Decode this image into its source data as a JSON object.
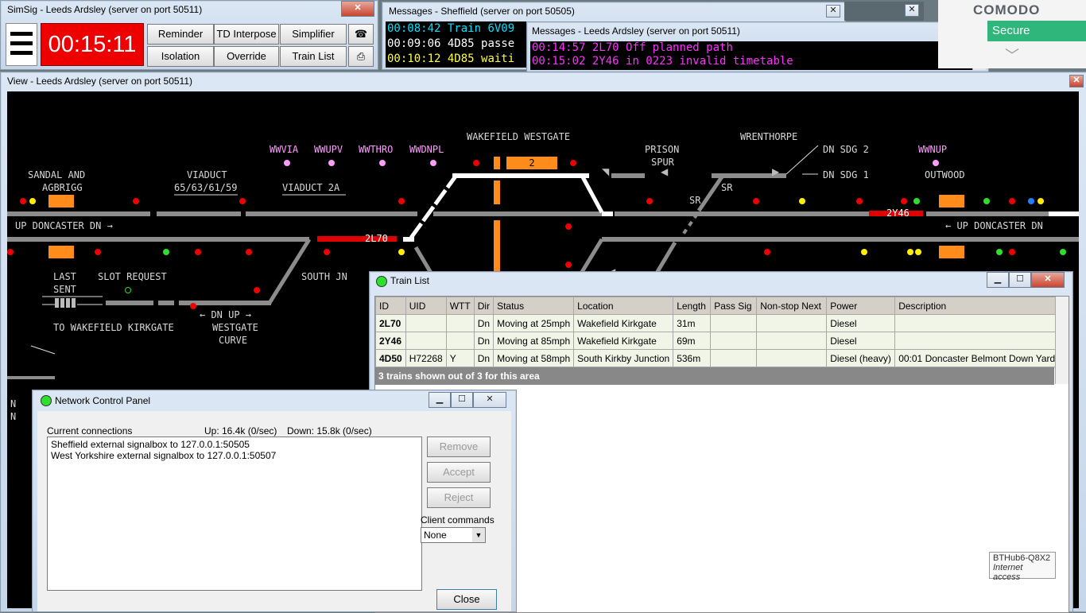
{
  "simsig": {
    "title": "SimSig - Leeds Ardsley (server on port 50511)",
    "clock": "00:15:11",
    "buttons": [
      "Reminder",
      "TD Interpose",
      "Simplifier",
      "Isolation",
      "Override",
      "Train List"
    ],
    "icons": [
      "phone-icon",
      "printer-icon"
    ]
  },
  "messages_sheffield": {
    "title": "Messages - Sheffield (server on port 50505)",
    "lines": [
      {
        "time": "00:08:42",
        "text": "Train 6V09",
        "color": "#00e0ff"
      },
      {
        "time": "00:09:06",
        "text": "4D85 passe",
        "color": "#ffffff"
      },
      {
        "time": "00:10:12",
        "text": "4D85 waiti",
        "color": "#ffff40"
      }
    ]
  },
  "messages_leeds": {
    "title": "Messages - Leeds Ardsley (server on port 50511)",
    "lines": [
      {
        "time": "00:14:57",
        "text": "2L70 Off planned path"
      },
      {
        "time": "00:15:02",
        "text": "2Y46 in 0223 invalid timetable"
      }
    ]
  },
  "comodo": {
    "brand": "COMODO",
    "status": "Secure"
  },
  "view": {
    "title": "View - Leeds Ardsley (server on port 50511)",
    "labels": {
      "sandal": "SANDAL AND",
      "agbrigg": "AGBRIGG",
      "viaduct": "VIADUCT",
      "viaduct_nums": "65/63/61/59",
      "viaduct_2a": "VIADUCT 2A",
      "wwvia": "WWVIA",
      "wwupv": "WWUPV",
      "wwthro": "WWTHRO",
      "wwdnpl": "WWDNPL",
      "wakefield_westgate": "WAKEFIELD WESTGATE",
      "platform_2": "2",
      "prison": "PRISON",
      "spur": "SPUR",
      "wrenthorpe": "WRENTHORPE",
      "dn_sdg_2": "DN SDG 2",
      "dn_sdg_1": "DN SDG 1",
      "wwnup": "WWNUP",
      "outwood": "OUTWOOD",
      "up_doncaster_dn_left": "UP DONCASTER DN",
      "up_doncaster_dn_right": "UP DONCASTER DN",
      "berth_2l70": "2L70",
      "berth_2y46": "2Y46",
      "sr1": "SR",
      "sr2": "SR",
      "last": "LAST",
      "sent": "SENT",
      "slot_request": "SLOT REQUEST",
      "south_jn": "SOUTH JN",
      "to_wakefield_kirkgate": "TO WAKEFIELD KIRKGATE",
      "dn_up": "DN UP",
      "westgate": "WESTGATE",
      "curve": "CURVE",
      "n1": "N",
      "n2": "N"
    }
  },
  "train_list": {
    "title": "Train List",
    "columns": [
      "ID",
      "UID",
      "WTT",
      "Dir",
      "Status",
      "Location",
      "Length",
      "Pass Sig",
      "Non-stop Next",
      "Power",
      "Description"
    ],
    "rows": [
      [
        "2L70",
        "",
        "",
        "Dn",
        "Moving at 25mph",
        "Wakefield Kirkgate",
        "31m",
        "",
        "",
        "Diesel",
        ""
      ],
      [
        "2Y46",
        "",
        "",
        "Dn",
        "Moving at 85mph",
        "Wakefield Kirkgate",
        "69m",
        "",
        "",
        "Diesel",
        ""
      ],
      [
        "4D50",
        "H72268",
        "Y",
        "Dn",
        "Moving at 58mph",
        "South Kirkby Junction",
        "536m",
        "",
        "",
        "Diesel (heavy)",
        "00:01 Doncaster Belmont Down Yard"
      ]
    ],
    "footer": "3 trains shown out of 3 for this area"
  },
  "network_panel": {
    "title": "Network Control Panel",
    "connections_label": "Current connections",
    "up": "Up: 16.4k (0/sec)",
    "down": "Down: 15.8k (0/sec)",
    "connections": [
      "Sheffield external signalbox to 127.0.0.1:50505",
      "West Yorkshire external signalbox to 127.0.0.1:50507"
    ],
    "remove": "Remove",
    "accept": "Accept",
    "reject": "Reject",
    "client_commands_label": "Client commands",
    "client_commands_value": "None",
    "close": "Close"
  },
  "tooltip": {
    "line1": "BTHub6-Q8X2",
    "line2": "Internet access"
  }
}
